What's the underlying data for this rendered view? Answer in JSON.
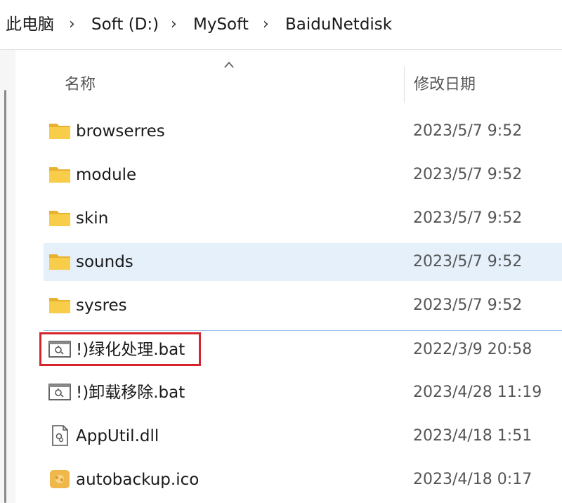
{
  "breadcrumb": {
    "items": [
      "此电脑",
      "Soft (D:)",
      "MySoft",
      "BaiduNetdisk"
    ],
    "separator": "›"
  },
  "columns": {
    "name": "名称",
    "modified": "修改日期",
    "sort_indicator": "ascending"
  },
  "files": [
    {
      "name": "browserres",
      "date": "2023/5/7 9:52",
      "icon": "folder-icon"
    },
    {
      "name": "module",
      "date": "2023/5/7 9:52",
      "icon": "folder-icon"
    },
    {
      "name": "skin",
      "date": "2023/5/7 9:52",
      "icon": "folder-icon"
    },
    {
      "name": "sounds",
      "date": "2023/5/7 9:52",
      "icon": "folder-icon",
      "state": "hover"
    },
    {
      "name": "sysres",
      "date": "2023/5/7 9:52",
      "icon": "folder-icon"
    },
    {
      "name": "!)绿化处理.bat",
      "date": "2022/3/9 20:58",
      "icon": "batch-file-icon",
      "state": "annotated"
    },
    {
      "name": "!)卸载移除.bat",
      "date": "2023/4/28 11:19",
      "icon": "batch-file-icon"
    },
    {
      "name": "AppUtil.dll",
      "date": "2023/4/18 1:51",
      "icon": "dll-file-icon"
    },
    {
      "name": "autobackup.ico",
      "date": "2023/4/18 0:17",
      "icon": "ico-file-icon"
    }
  ],
  "colors": {
    "folder": "#f4c542",
    "hover_row": "#e5f0fb",
    "annotation_box": "#d3252b"
  }
}
